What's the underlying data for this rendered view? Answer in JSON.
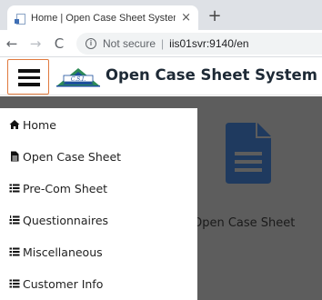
{
  "browser": {
    "tab_title": "Home | Open Case Sheet System",
    "tab_close": "×",
    "new_tab": "+",
    "back": "←",
    "forward": "→",
    "reload": "C",
    "info_glyph": "i",
    "security_text": "Not secure",
    "separator": "|",
    "url": "iis01svr:9140/en"
  },
  "header": {
    "menu_button": "hamburger-menu",
    "logo_text": "C.S.I.",
    "title": "Open Case Sheet System",
    "accent_color": "#e07a3e"
  },
  "sidebar": {
    "items": [
      {
        "label": "Home",
        "icon": "home-icon"
      },
      {
        "label": "Open Case Sheet",
        "icon": "file-icon"
      },
      {
        "label": "Pre-Com Sheet",
        "icon": "list-icon"
      },
      {
        "label": "Questionnaires",
        "icon": "list-ol-icon"
      },
      {
        "label": "Miscellaneous",
        "icon": "list-icon"
      },
      {
        "label": "Customer Info",
        "icon": "list-icon"
      }
    ]
  },
  "main": {
    "card_label": "Open Case Sheet",
    "card_icon": "document-icon",
    "card_icon_color": "#1f3a5f",
    "overlay_color": "#5d5d5d"
  }
}
